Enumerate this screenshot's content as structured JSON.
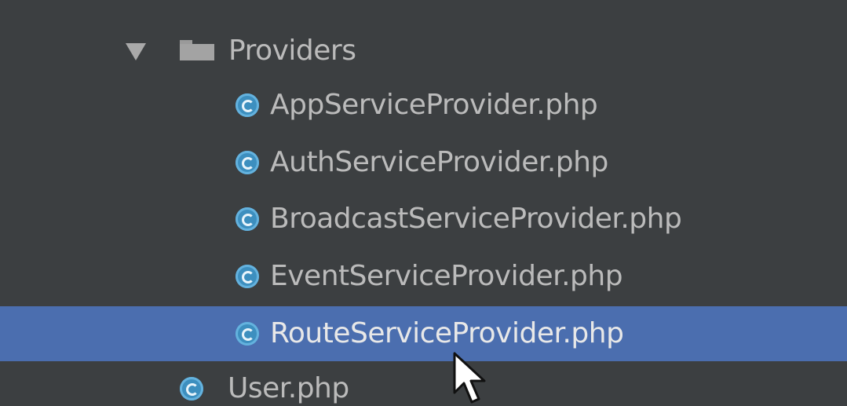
{
  "project_tree": {
    "folder": {
      "name": "Providers",
      "expanded": true,
      "toggle_icon": "expanded-arrow-icon",
      "folder_icon": "folder-icon"
    },
    "files": [
      {
        "name": "AppServiceProvider.php",
        "icon": "php-class-icon",
        "selected": false
      },
      {
        "name": "AuthServiceProvider.php",
        "icon": "php-class-icon",
        "selected": false
      },
      {
        "name": "BroadcastServiceProvider.php",
        "icon": "php-class-icon",
        "selected": false
      },
      {
        "name": "EventServiceProvider.php",
        "icon": "php-class-icon",
        "selected": false
      },
      {
        "name": "RouteServiceProvider.php",
        "icon": "php-class-icon",
        "selected": true
      }
    ],
    "sibling": {
      "name": "User.php",
      "icon": "php-class-icon"
    }
  },
  "colors": {
    "background": "#3c3f41",
    "selection": "#4b6eaf",
    "text": "#bbbbbb",
    "class_icon": "#3d8fbf"
  }
}
